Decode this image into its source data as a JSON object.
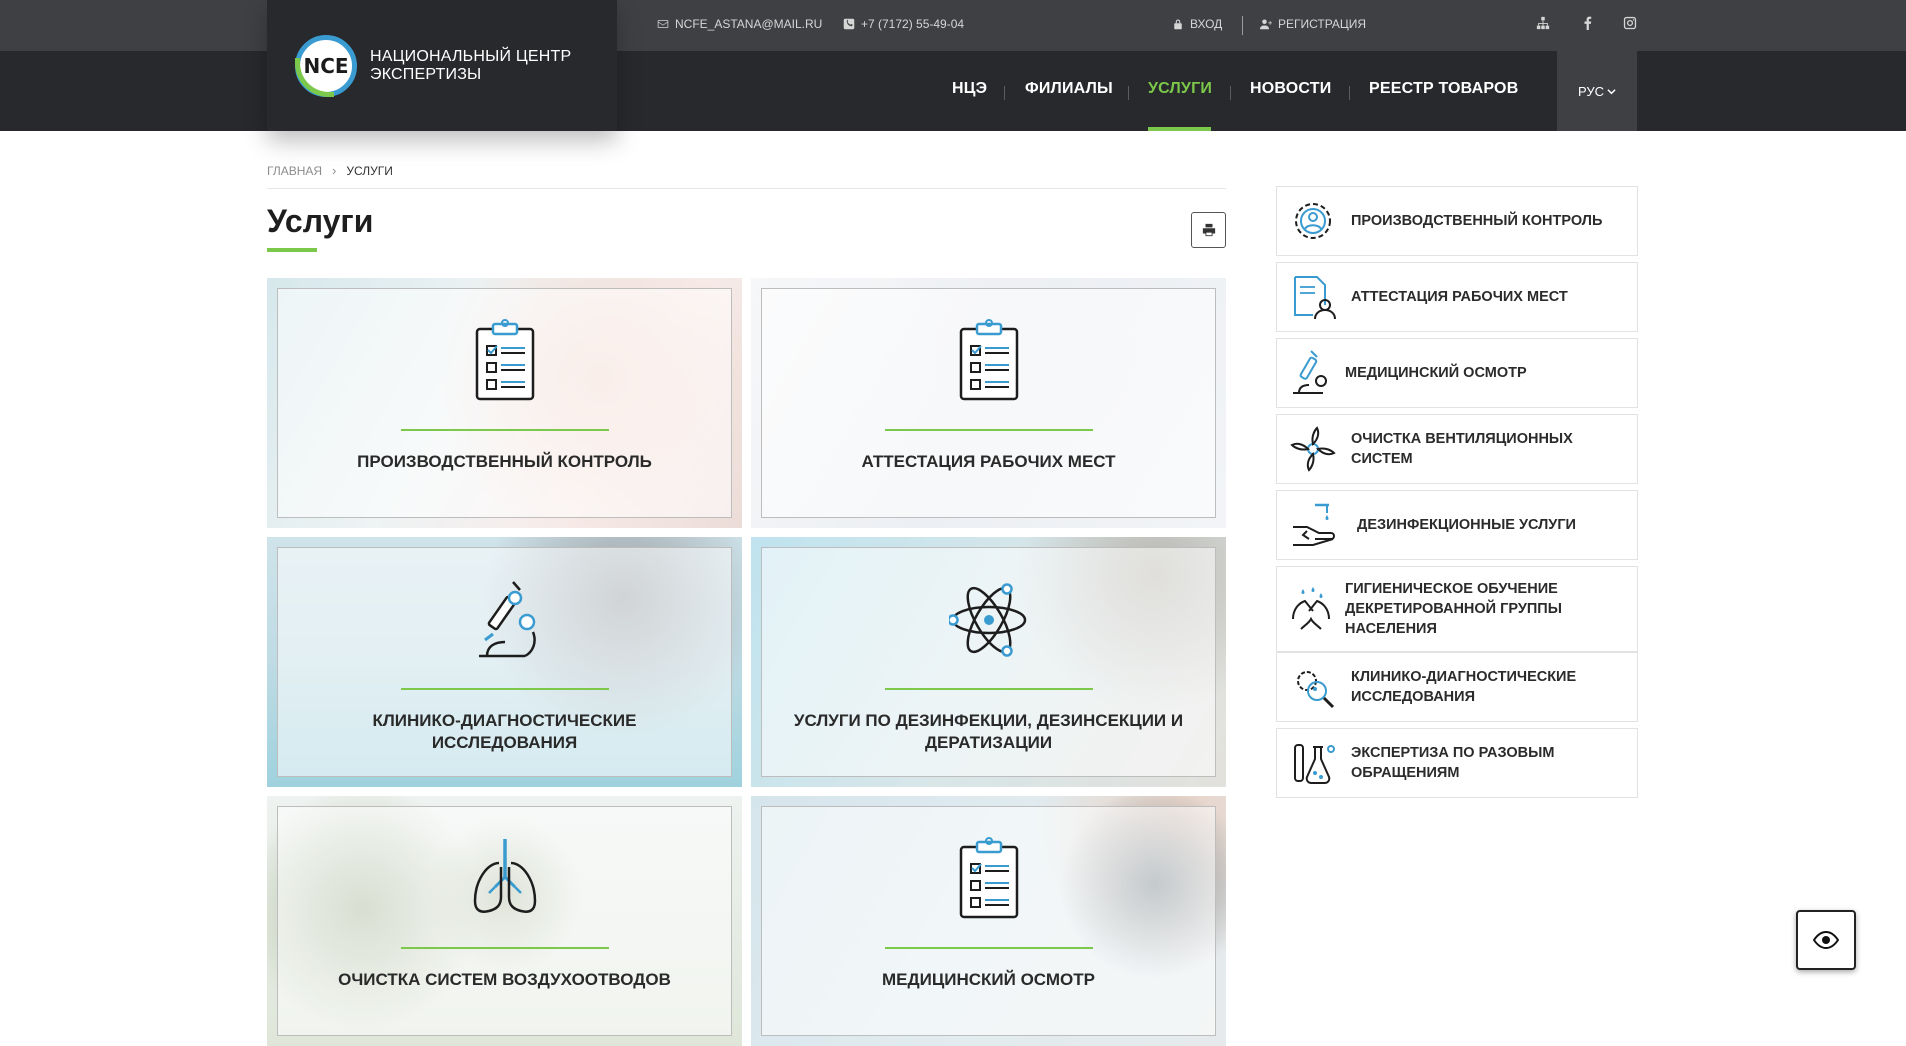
{
  "header": {
    "logo_mark": "NCE",
    "logo_text_1": "НАЦИОНАЛЬНЫЙ ЦЕНТР",
    "logo_text_2": "ЭКСПЕРТИЗЫ",
    "email": "NCFE_ASTANA@MAIL.RU",
    "phone": "+7 (7172) 55-49-04",
    "login": "ВХОД",
    "register": "РЕГИСТРАЦИЯ",
    "lang": "РУС"
  },
  "nav": {
    "items": [
      "НЦЭ",
      "ФИЛИАЛЫ",
      "УСЛУГИ",
      "НОВОСТИ",
      "РЕЕСТР ТОВАРОВ"
    ],
    "active": "УСЛУГИ"
  },
  "breadcrumb": {
    "home": "ГЛАВНАЯ",
    "current": "УСЛУГИ"
  },
  "page": {
    "title": "Услуги"
  },
  "cards": [
    {
      "title": "ПРОИЗВОДСТВЕННЫЙ КОНТРОЛЬ",
      "icon": "clipboard-checklist-icon"
    },
    {
      "title": "АТТЕСТАЦИЯ РАБОЧИХ МЕСТ",
      "icon": "clipboard-checklist-icon"
    },
    {
      "title": "КЛИНИКО-ДИАГНОСТИЧЕСКИЕ ИССЛЕДОВАНИЯ",
      "icon": "microscope-icon"
    },
    {
      "title": "УСЛУГИ ПО ДЕЗИНФЕКЦИИ, ДЕЗИНСЕКЦИИ И ДЕРАТИЗАЦИИ",
      "icon": "atom-icon"
    },
    {
      "title": "ОЧИСТКА СИСТЕМ ВОЗДУХООТВОДОВ",
      "icon": "lungs-icon"
    },
    {
      "title": "МЕДИЦИНСКИЙ ОСМОТР",
      "icon": "clipboard-checklist-icon"
    }
  ],
  "sidebar": {
    "items": [
      "ПРОИЗВОДСТВЕННЫЙ КОНТРОЛЬ",
      "АТТЕСТАЦИЯ РАБОЧИХ МЕСТ",
      "МЕДИЦИНСКИЙ ОСМОТР",
      "ОЧИСТКА ВЕНТИЛЯЦИОННЫХ СИСТЕМ",
      "ДЕЗИНФЕКЦИОННЫЕ УСЛУГИ",
      "ГИГИЕНИЧЕСКОЕ ОБУЧЕНИЕ ДЕКРЕТИРОВАННОЙ ГРУППЫ НАСЕЛЕНИЯ",
      "КЛИНИКО-ДИАГНОСТИЧЕСКИЕ ИССЛЕДОВАНИЯ",
      "ЭКСПЕРТИЗА ПО РАЗОВЫМ ОБРАЩЕНИЯМ"
    ]
  },
  "colors": {
    "accent": "#7cc84a",
    "blue": "#3a9bd1",
    "dark": "#27292c",
    "topbar": "#3e4043"
  }
}
